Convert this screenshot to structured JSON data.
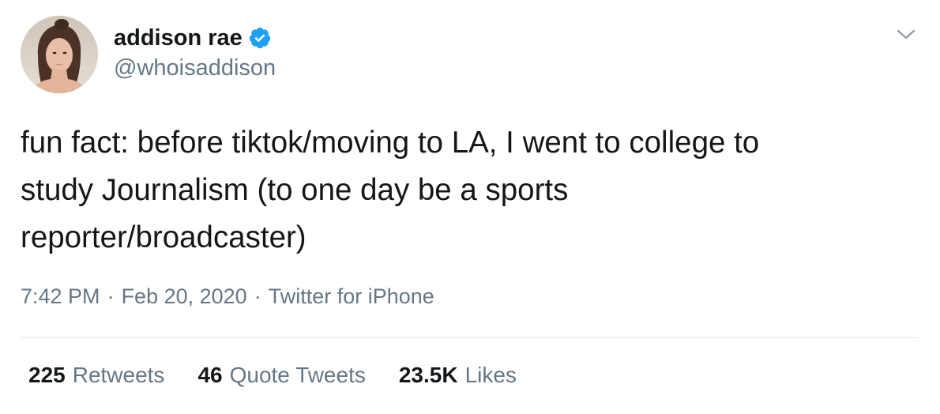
{
  "author": {
    "display_name": "addison rae",
    "handle": "@whoisaddison",
    "verified_icon": "verified-badge-icon",
    "verified_color": "#1da1f2"
  },
  "menu_icon": "chevron-down-icon",
  "tweet": {
    "lines": [
      "fun fact: before tiktok/moving to LA, I went to college to",
      "study Journalism (to one day be a sports",
      "reporter/broadcaster)"
    ],
    "time": "7:42 PM",
    "date": "Feb 20, 2020",
    "source": "Twitter for iPhone",
    "separator": "·"
  },
  "stats": {
    "retweets_count": "225",
    "retweets_label": "Retweets",
    "quotes_count": "46",
    "quotes_label": "Quote Tweets",
    "likes_count": "23.5K",
    "likes_label": "Likes"
  },
  "colors": {
    "text": "#14171a",
    "secondary": "#657786",
    "divider": "#e1e8ed"
  }
}
